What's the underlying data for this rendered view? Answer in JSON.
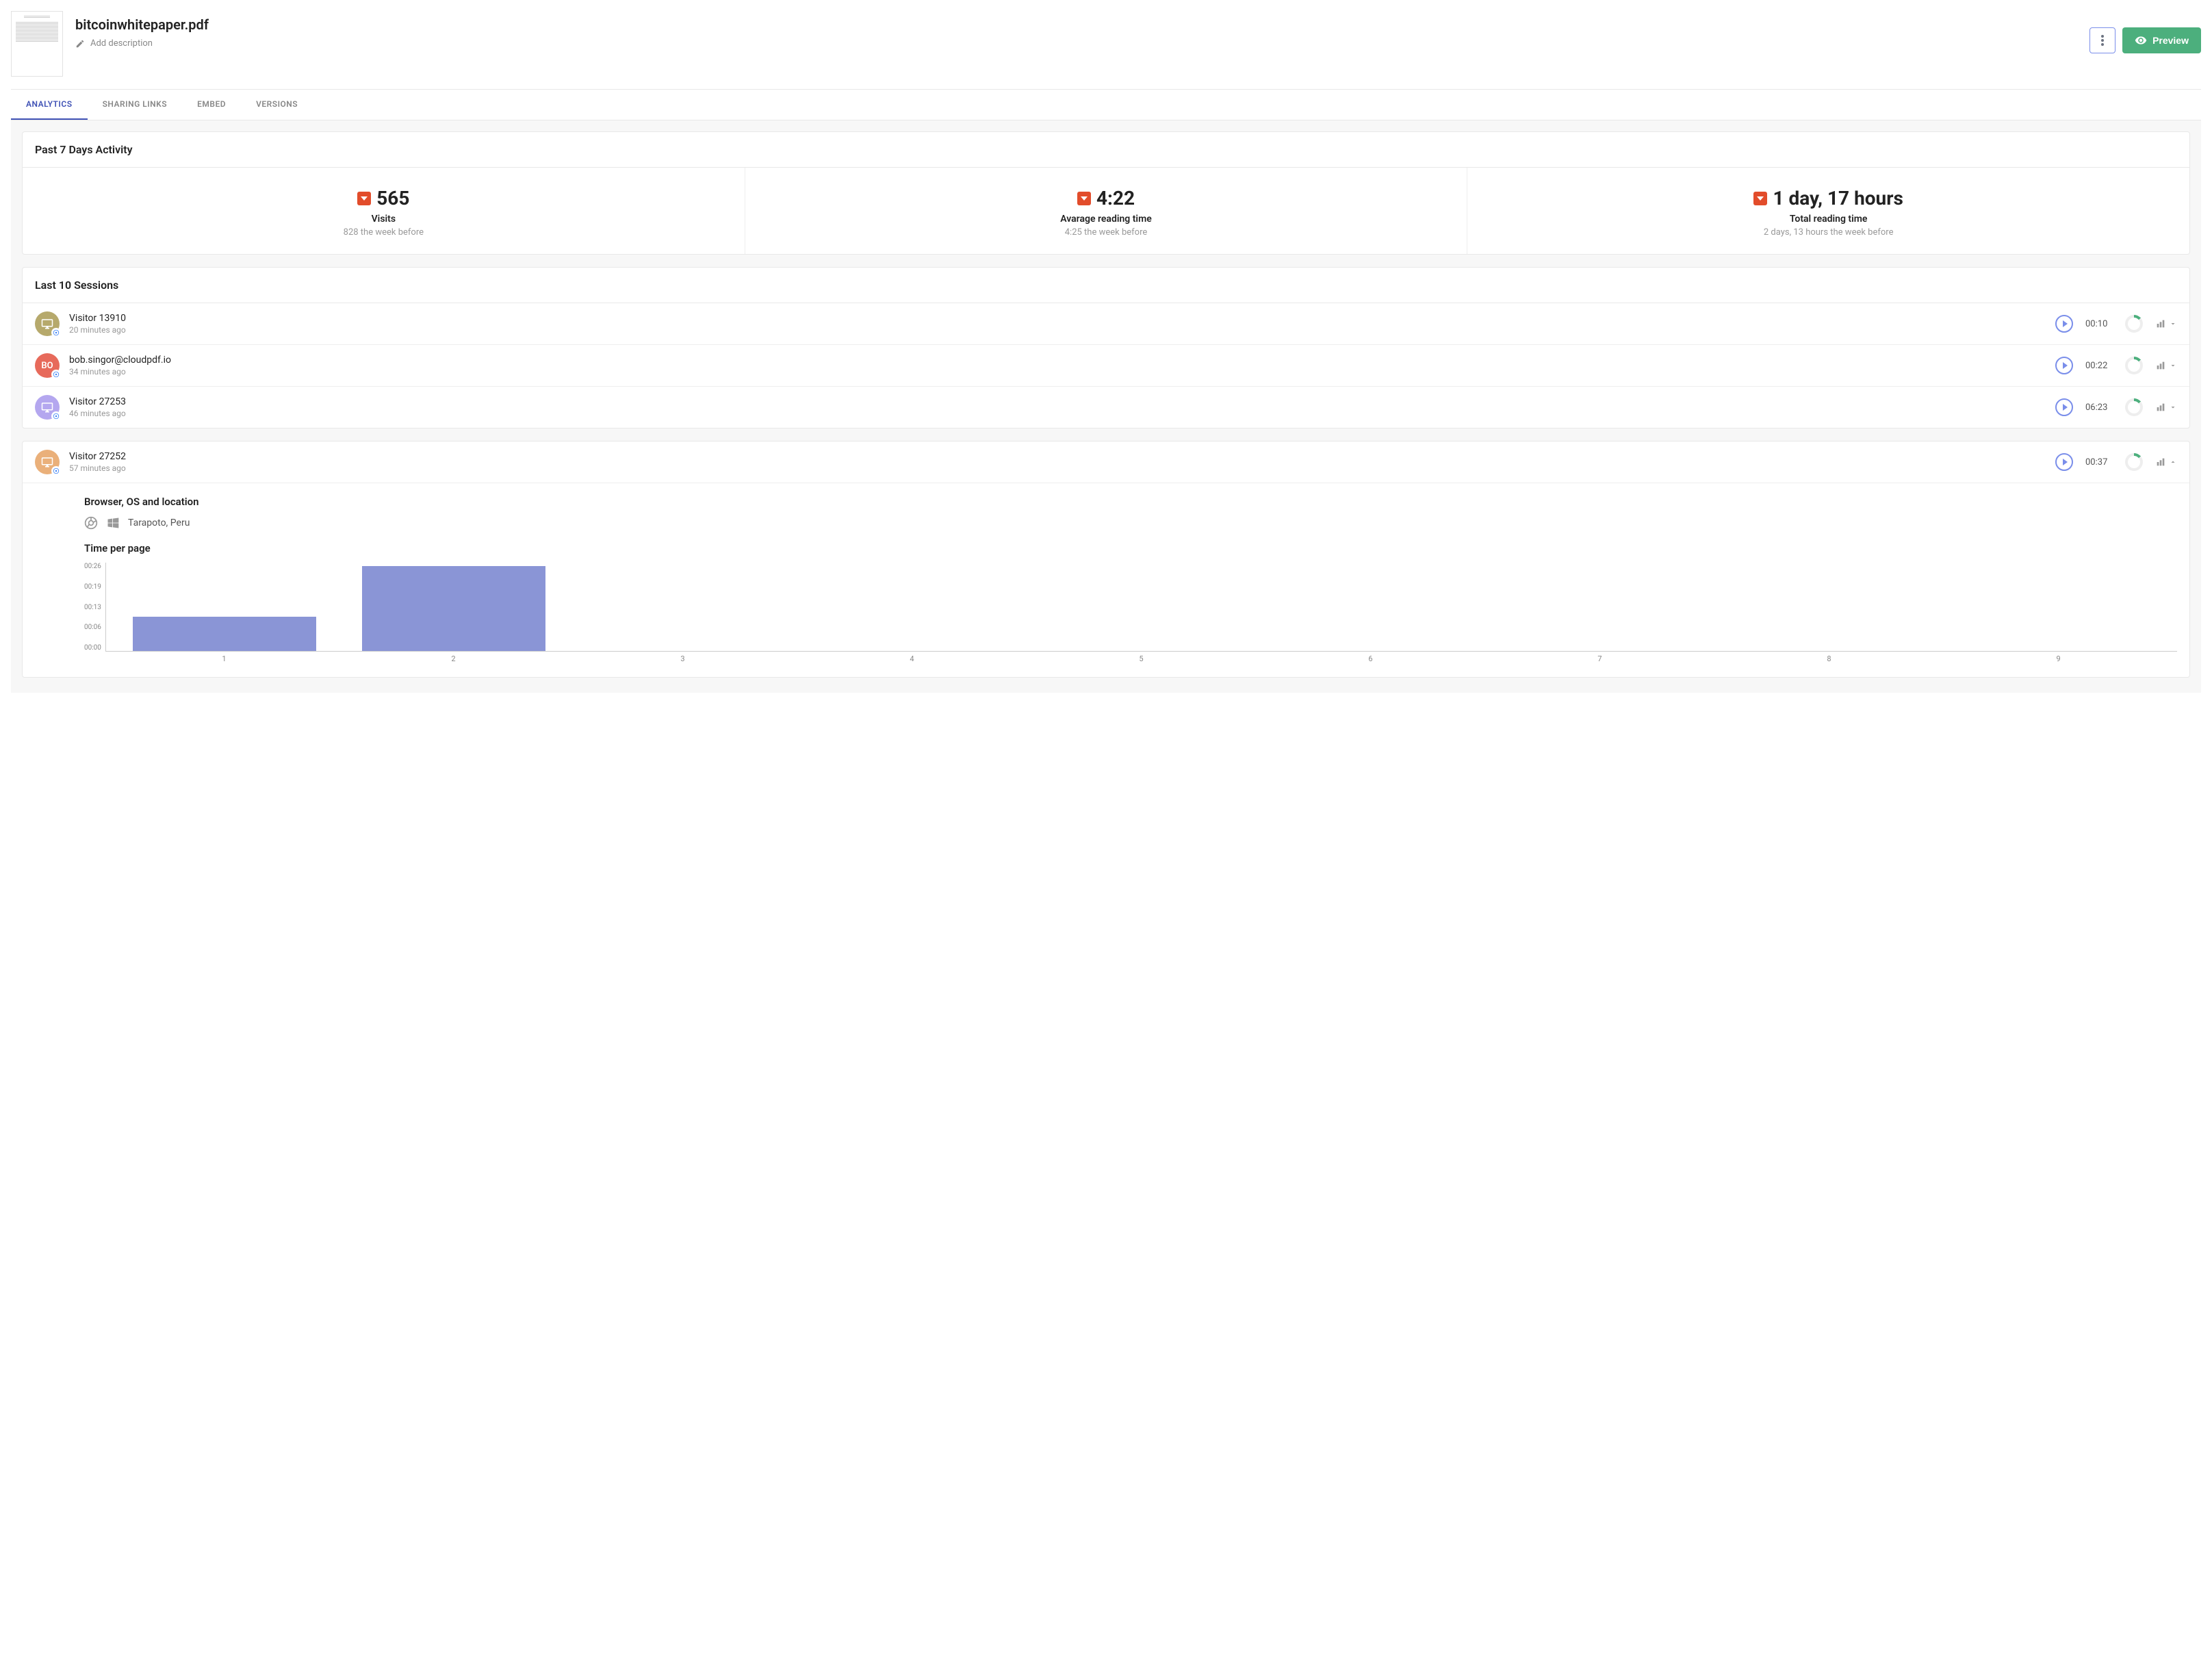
{
  "header": {
    "title": "bitcoinwhitepaper.pdf",
    "add_description": "Add description",
    "preview_label": "Preview"
  },
  "tabs": [
    {
      "label": "ANALYTICS",
      "active": true
    },
    {
      "label": "SHARING LINKS",
      "active": false
    },
    {
      "label": "EMBED",
      "active": false
    },
    {
      "label": "VERSIONS",
      "active": false
    }
  ],
  "activity": {
    "title": "Past 7 Days Activity",
    "stats": [
      {
        "value": "565",
        "label": "Visits",
        "sub": "828 the week before"
      },
      {
        "value": "4:22",
        "label": "Avarage reading time",
        "sub": "4:25 the week before"
      },
      {
        "value": "1 day, 17 hours",
        "label": "Total reading time",
        "sub": "2 days, 13 hours the week before"
      }
    ]
  },
  "sessions_title": "Last 10 Sessions",
  "sessions": [
    {
      "name": "Visitor 13910",
      "time": "20 minutes ago",
      "duration": "00:10",
      "avatar_type": "device",
      "avatar_bg": "#b6a96c",
      "expanded": false
    },
    {
      "name": "bob.singor@cloudpdf.io",
      "time": "34 minutes ago",
      "duration": "00:22",
      "avatar_type": "initials",
      "avatar_text": "BO",
      "avatar_bg": "#e76a5b",
      "expanded": false
    },
    {
      "name": "Visitor 27253",
      "time": "46 minutes ago",
      "duration": "06:23",
      "avatar_type": "device",
      "avatar_bg": "#b4a7ef",
      "expanded": false
    },
    {
      "name": "Visitor 27252",
      "time": "57 minutes ago",
      "duration": "00:37",
      "avatar_type": "device",
      "avatar_bg": "#eab07a",
      "expanded": true
    }
  ],
  "detail": {
    "bol_title": "Browser, OS and location",
    "location": "Tarapoto, Peru",
    "tpp_title": "Time per page"
  },
  "chart_data": {
    "type": "bar",
    "categories": [
      "1",
      "2",
      "3",
      "4",
      "5",
      "6",
      "7",
      "8",
      "9"
    ],
    "values_seconds": [
      10,
      25,
      0,
      0,
      0,
      0,
      0,
      0,
      0
    ],
    "y_ticks": [
      "00:26",
      "00:19",
      "00:13",
      "00:06",
      "00:00"
    ],
    "y_max_seconds": 26,
    "title": "Time per page",
    "xlabel": "",
    "ylabel": ""
  }
}
